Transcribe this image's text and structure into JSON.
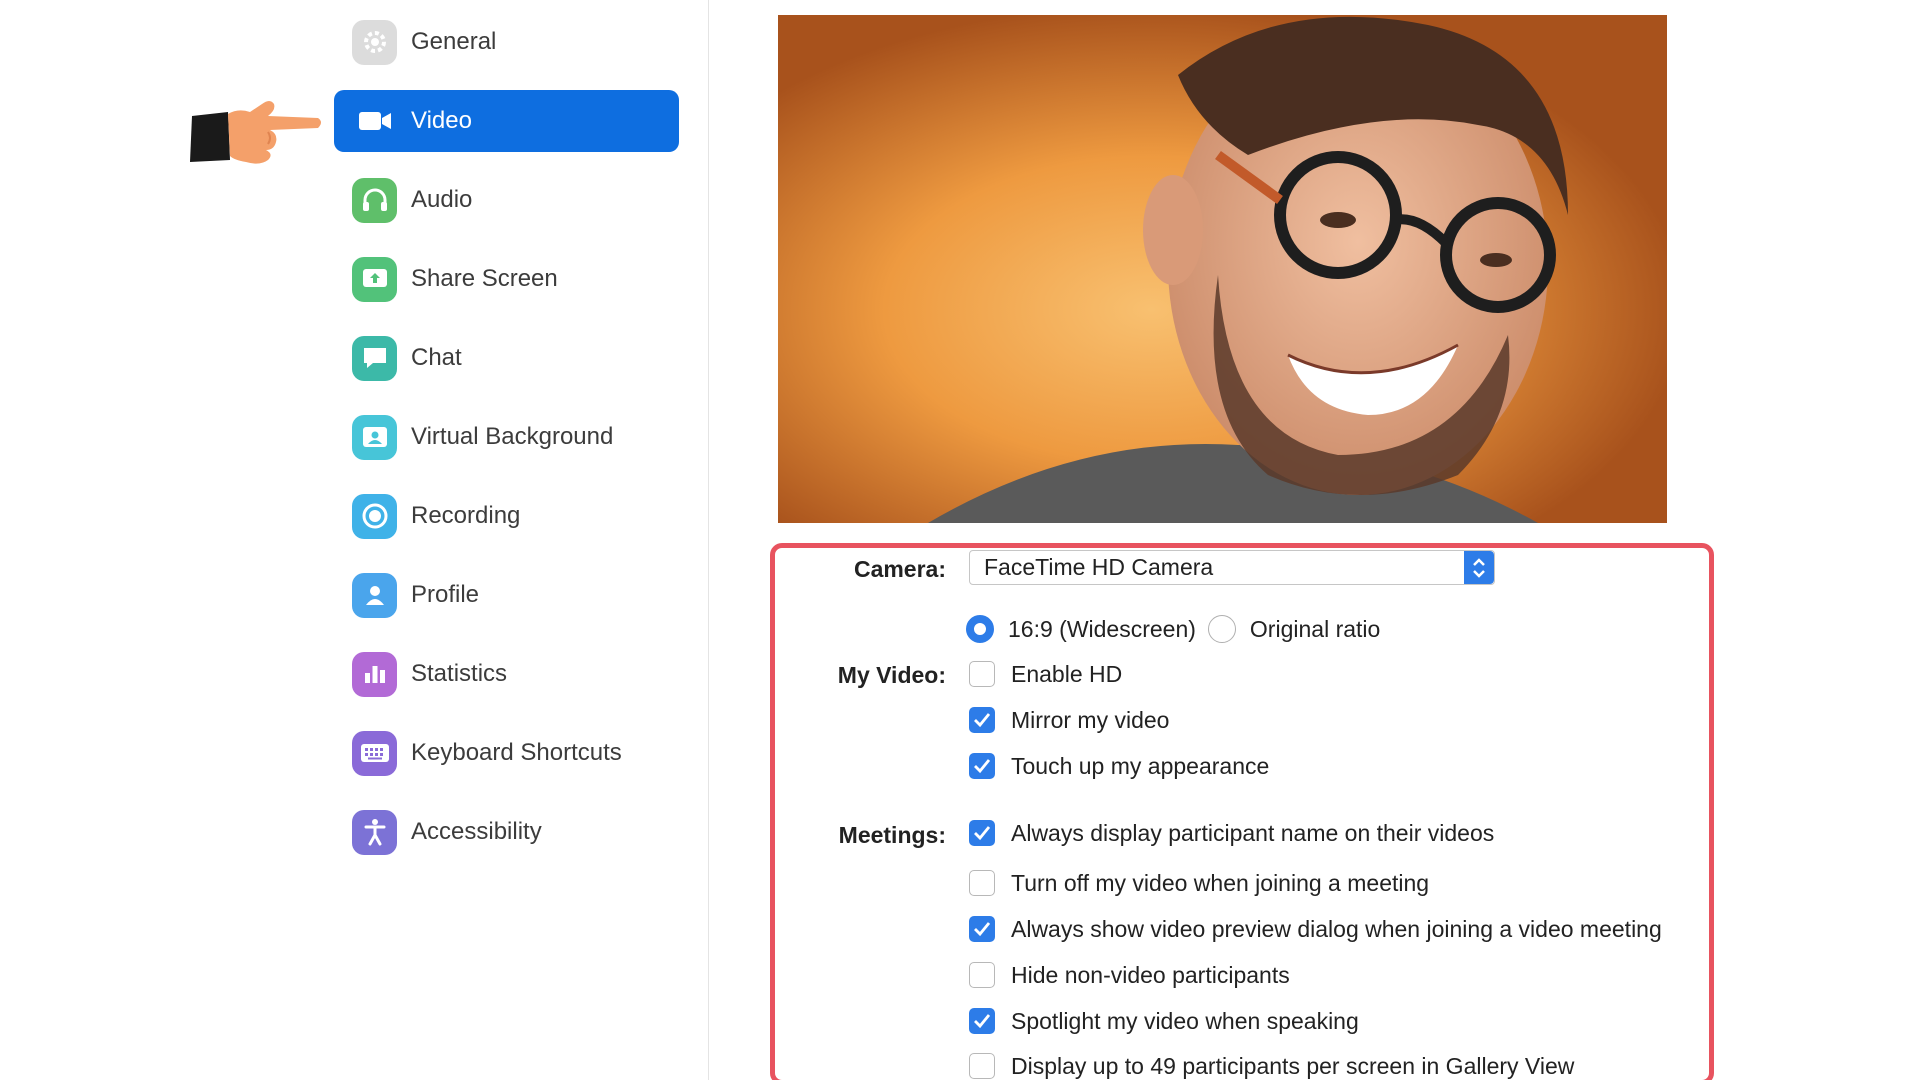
{
  "sidebar": {
    "items": [
      {
        "label": "General",
        "icon": "gear-icon",
        "color": "#dcdcdc",
        "active": false
      },
      {
        "label": "Video",
        "icon": "video-camera-icon",
        "color": "#0e6ee0",
        "active": true
      },
      {
        "label": "Audio",
        "icon": "headphones-icon",
        "color": "#5fbf6a",
        "active": false
      },
      {
        "label": "Share Screen",
        "icon": "share-screen-icon",
        "color": "#52c27a",
        "active": false
      },
      {
        "label": "Chat",
        "icon": "chat-bubble-icon",
        "color": "#3cb9a8",
        "active": false
      },
      {
        "label": "Virtual Background",
        "icon": "virtual-background-icon",
        "color": "#47c5d8",
        "active": false
      },
      {
        "label": "Recording",
        "icon": "recording-icon",
        "color": "#3fb2e8",
        "active": false
      },
      {
        "label": "Profile",
        "icon": "profile-icon",
        "color": "#4aa5ec",
        "active": false
      },
      {
        "label": "Statistics",
        "icon": "statistics-icon",
        "color": "#b26ad6",
        "active": false
      },
      {
        "label": "Keyboard Shortcuts",
        "icon": "keyboard-icon",
        "color": "#8a6ad8",
        "active": false
      },
      {
        "label": "Accessibility",
        "icon": "accessibility-icon",
        "color": "#7c72d6",
        "active": false
      }
    ]
  },
  "settings": {
    "camera_label": "Camera:",
    "camera_value": "FaceTime HD Camera",
    "my_video_label": "My Video:",
    "meetings_label": "Meetings:",
    "ratio_options": [
      {
        "label": "16:9 (Widescreen)",
        "selected": true
      },
      {
        "label": "Original ratio",
        "selected": false
      }
    ],
    "my_video_options": [
      {
        "label": "Enable HD",
        "checked": false
      },
      {
        "label": "Mirror my video",
        "checked": true
      },
      {
        "label": "Touch up my appearance",
        "checked": true
      }
    ],
    "meeting_options": [
      {
        "label": "Always display participant name on their videos",
        "checked": true
      },
      {
        "label": "Turn off my video when joining a meeting",
        "checked": false
      },
      {
        "label": "Always show video preview dialog when joining a video meeting",
        "checked": true
      },
      {
        "label": "Hide non-video participants",
        "checked": false
      },
      {
        "label": "Spotlight my video when speaking",
        "checked": true
      },
      {
        "label": "Display up to 49 participants per screen in Gallery View",
        "checked": false
      }
    ]
  },
  "colors": {
    "accent": "#2d7ce8",
    "active_nav": "#0e6ee0",
    "highlight_border": "#e8535f"
  }
}
